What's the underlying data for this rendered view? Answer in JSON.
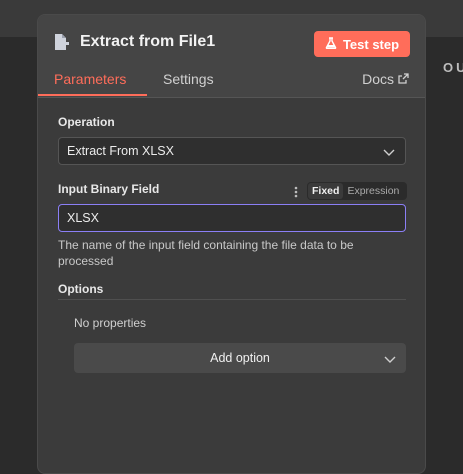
{
  "panel": {
    "title": "Extract from File1",
    "test_step_label": "Test step",
    "tabs": [
      {
        "label": "Parameters",
        "active": true
      },
      {
        "label": "Settings",
        "active": false
      }
    ],
    "docs_label": "Docs"
  },
  "background": {
    "partial_label": "OU"
  },
  "fields": {
    "operation": {
      "label": "Operation",
      "value": "Extract From XLSX"
    },
    "input_binary": {
      "label": "Input Binary Field",
      "value": "XLSX",
      "mode_fixed": "Fixed",
      "mode_expression": "Expression",
      "hint": "The name of the input field containing the file data to be processed"
    }
  },
  "options": {
    "label": "Options",
    "empty_text": "No properties",
    "add_label": "Add option"
  },
  "colors": {
    "accent": "#ff6d5a",
    "focus_border": "#8b7ff6"
  },
  "icons": [
    "file-extract-icon",
    "flask-icon",
    "external-link-icon",
    "chevron-down-icon",
    "more-vertical-icon"
  ]
}
